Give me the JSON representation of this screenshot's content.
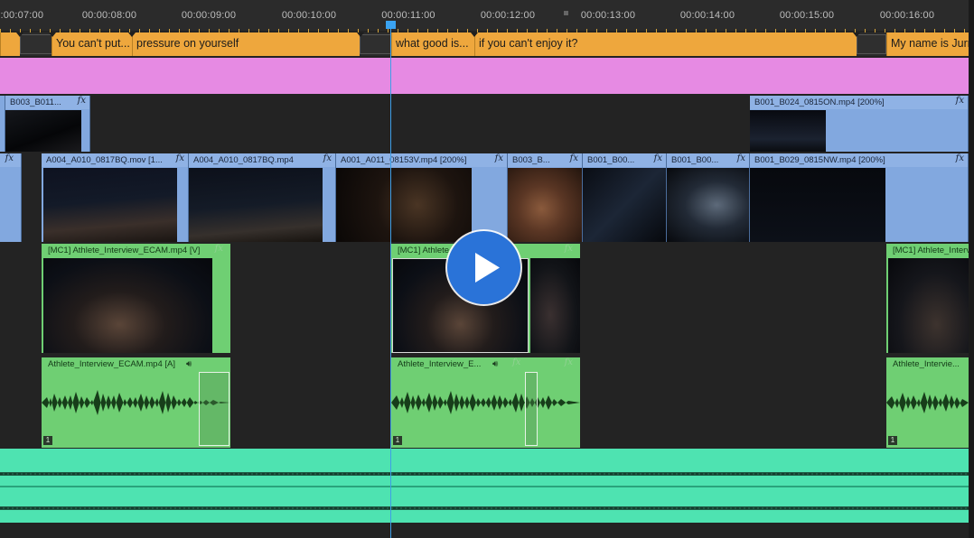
{
  "ruler": {
    "timecodes": [
      "00:00:07:00",
      "00:00:08:00",
      "00:00:09:00",
      "00:00:10:00",
      "00:00:11:00",
      "00:00:12:00",
      "00:00:13:00",
      "00:00:14:00",
      "00:00:15:00",
      "00:00:16:00"
    ],
    "current_time": "00:00:11:00"
  },
  "captions": [
    {
      "text": "You can't put..."
    },
    {
      "text": "pressure on yourself"
    },
    {
      "text": "what good is..."
    },
    {
      "text": "if you can't enjoy it?"
    },
    {
      "text": "My name is Jurr"
    }
  ],
  "video_track_upper": [
    {
      "label": "B003_B011..."
    },
    {
      "label": "B001_B024_0815ON.mp4 [200%]"
    }
  ],
  "video_track_main": [
    {
      "label": ""
    },
    {
      "label": "A004_A010_0817BQ.mov [1..."
    },
    {
      "label": "A004_A010_0817BQ.mp4"
    },
    {
      "label": "A001_A011_08153V.mp4 [200%]"
    },
    {
      "label": "B003_B..."
    },
    {
      "label": "B001_B00..."
    },
    {
      "label": "B001_B00..."
    },
    {
      "label": "B001_B029_0815NW.mp4 [200%]"
    }
  ],
  "fx_symbol": "fx",
  "interview_video": [
    {
      "label": "[MC1] Athlete_Interview_ECAM.mp4 [V]"
    },
    {
      "label": "[MC1] Athlete_"
    },
    {
      "label": "[MC1] Athlete_Interv"
    }
  ],
  "interview_audio": [
    {
      "label": "Athlete_Interview_ECAM.mp4 [A]",
      "channel": "1"
    },
    {
      "label": "Athlete_Interview_E...",
      "channel": "1"
    },
    {
      "label": "Athlete_Intervie...",
      "channel": "1"
    }
  ],
  "colors": {
    "caption": "#eea73d",
    "pink_track": "#e68ae3",
    "video_clip": "#82a8df",
    "interview_clip": "#6fcf73",
    "mix_track": "#4ee3b1",
    "playhead": "#3f9ee6",
    "play_button": "#2a73d8"
  },
  "icons": {
    "play": "play-icon",
    "audio": "speaker-icon"
  }
}
